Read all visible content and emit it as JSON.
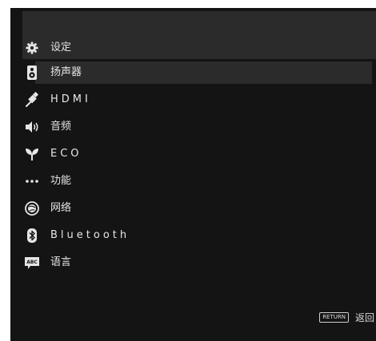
{
  "header": {
    "icon": "gear-icon",
    "title": "设定"
  },
  "menu": {
    "items": [
      {
        "label": "扬声器",
        "icon": "speaker-icon",
        "selected": true
      },
      {
        "label": "HDMI",
        "icon": "hdmi-cable-icon",
        "selected": false
      },
      {
        "label": "音频",
        "icon": "audio-icon",
        "selected": false
      },
      {
        "label": "ECO",
        "icon": "eco-leaf-icon",
        "selected": false
      },
      {
        "label": "功能",
        "icon": "more-dots-icon",
        "selected": false
      },
      {
        "label": "网络",
        "icon": "network-globe-icon",
        "selected": false
      },
      {
        "label": "Bluetooth",
        "icon": "bluetooth-icon",
        "selected": false
      },
      {
        "label": "语言",
        "icon": "language-abc-icon",
        "selected": false
      }
    ]
  },
  "footer": {
    "return_key": "RETURN",
    "return_label": "返回"
  },
  "colors": {
    "background": "#141414",
    "panel": "#2b2b2b",
    "text": "#e6e6e6"
  }
}
